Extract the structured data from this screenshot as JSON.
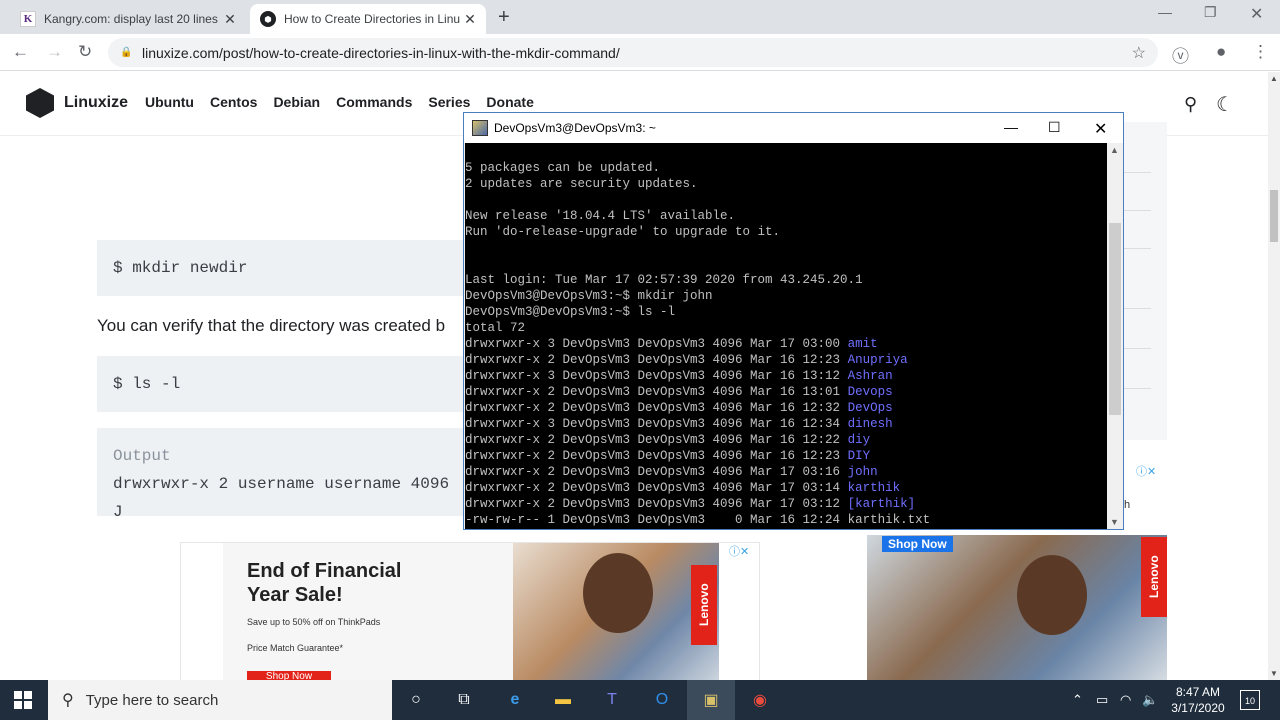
{
  "browser": {
    "tabs": [
      {
        "title": "Kangry.com: display last 20 lines",
        "favicon": "K"
      },
      {
        "title": "How to Create Directories in Linux",
        "favicon": "L"
      }
    ],
    "new_tab": "+",
    "url": "linuxize.com/post/how-to-create-directories-in-linux-with-the-mkdir-command/",
    "icons": {
      "back": "back-arrow-icon",
      "forward": "forward-arrow-icon",
      "reload": "reload-icon",
      "lock": "lock-icon",
      "star": "star-icon",
      "profile": "profile-icon",
      "menu": "kebab-menu-icon"
    }
  },
  "site": {
    "brand": "Linuxize",
    "menu": [
      "Ubuntu",
      "Centos",
      "Debian",
      "Commands",
      "Series",
      "Donate"
    ]
  },
  "article": {
    "code1": "$ mkdir newdir",
    "paragraph": "You can verify that the directory was created b",
    "code2": "$ ls -l",
    "output_label": "Output",
    "output_line": "drwxrwxr-x 2 username username 4096 J"
  },
  "ads": {
    "ad1_headline_1": "End of Financial",
    "ad1_headline_2": "Year Sale!",
    "ad1_bullet_1": "Save up to 50% off on ThinkPads",
    "ad1_bullet_2": "Price Match Guarantee*",
    "ad1_button": "Shop Now",
    "lenovo": "Lenovo",
    "ad2_button": "Shop Now",
    "ad2_side": "h"
  },
  "putty": {
    "title": "DevOpsVm3@DevOpsVm3: ~",
    "lines": [
      {
        "text": "5 packages can be updated."
      },
      {
        "text": "2 updates are security updates."
      },
      {
        "text": ""
      },
      {
        "text": "New release '18.04.4 LTS' available."
      },
      {
        "text": "Run 'do-release-upgrade' to upgrade to it."
      },
      {
        "text": ""
      },
      {
        "text": ""
      },
      {
        "text": "Last login: Tue Mar 17 02:57:39 2020 from 43.245.20.1"
      },
      {
        "text": "DevOpsVm3@DevOpsVm3:~$ mkdir john"
      },
      {
        "text": "DevOpsVm3@DevOpsVm3:~$ ls -l"
      },
      {
        "text": "total 72"
      }
    ],
    "listing": [
      {
        "meta": "drwxrwxr-x 3 DevOpsVm3 DevOpsVm3 4096 Mar 17 03:00 ",
        "name": "amit"
      },
      {
        "meta": "drwxrwxr-x 2 DevOpsVm3 DevOpsVm3 4096 Mar 16 12:23 ",
        "name": "Anupriya"
      },
      {
        "meta": "drwxrwxr-x 3 DevOpsVm3 DevOpsVm3 4096 Mar 16 13:12 ",
        "name": "Ashran"
      },
      {
        "meta": "drwxrwxr-x 2 DevOpsVm3 DevOpsVm3 4096 Mar 16 13:01 ",
        "name": "Devops"
      },
      {
        "meta": "drwxrwxr-x 2 DevOpsVm3 DevOpsVm3 4096 Mar 16 12:32 ",
        "name": "DevOps"
      },
      {
        "meta": "drwxrwxr-x 3 DevOpsVm3 DevOpsVm3 4096 Mar 16 12:34 ",
        "name": "dinesh"
      },
      {
        "meta": "drwxrwxr-x 2 DevOpsVm3 DevOpsVm3 4096 Mar 16 12:22 ",
        "name": "diy"
      },
      {
        "meta": "drwxrwxr-x 2 DevOpsVm3 DevOpsVm3 4096 Mar 16 12:23 ",
        "name": "DIY"
      },
      {
        "meta": "drwxrwxr-x 2 DevOpsVm3 DevOpsVm3 4096 Mar 17 03:16 ",
        "name": "john"
      },
      {
        "meta": "drwxrwxr-x 2 DevOpsVm3 DevOpsVm3 4096 Mar 17 03:14 ",
        "name": "karthik"
      },
      {
        "meta": "drwxrwxr-x 2 DevOpsVm3 DevOpsVm3 4096 Mar 17 03:12 ",
        "name": "[karthik]"
      },
      {
        "meta": "-rw-rw-r-- 1 DevOpsVm3 DevOpsVm3    0 Mar 16 12:24 ",
        "name": "karthik.txt"
      }
    ],
    "dir_color": "#6f6fff"
  },
  "taskbar": {
    "search_placeholder": "Type here to search",
    "time": "8:47 AM",
    "date": "3/17/2020",
    "notifications": "10"
  }
}
